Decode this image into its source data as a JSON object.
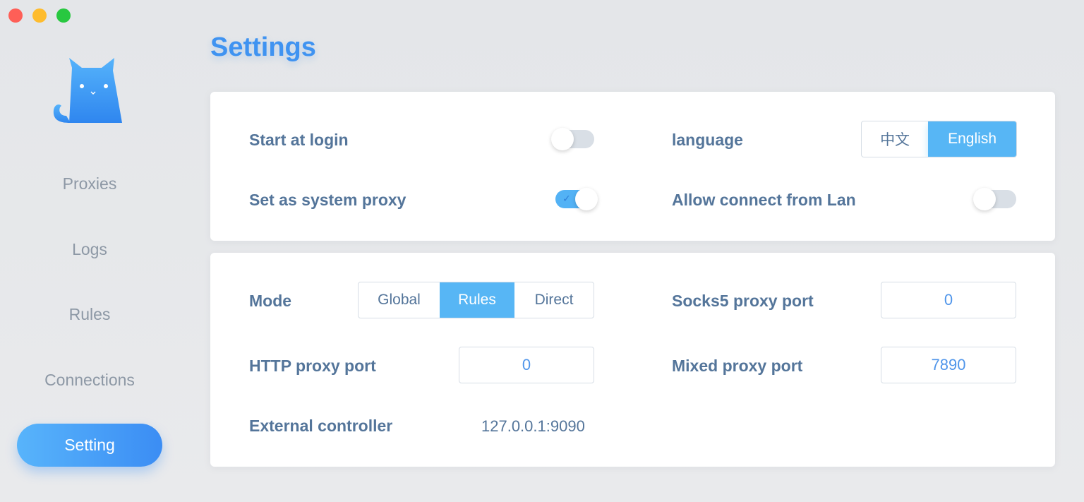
{
  "window": {
    "title": "Settings"
  },
  "sidebar": {
    "items": [
      {
        "label": "Proxies"
      },
      {
        "label": "Logs"
      },
      {
        "label": "Rules"
      },
      {
        "label": "Connections"
      },
      {
        "label": "Setting"
      }
    ],
    "active": "Setting"
  },
  "general": {
    "start_at_login": {
      "label": "Start at login",
      "enabled": false
    },
    "system_proxy": {
      "label": "Set as system proxy",
      "enabled": true
    },
    "language": {
      "label": "language",
      "options": [
        "中文",
        "English"
      ],
      "selected": "English"
    },
    "allow_lan": {
      "label": "Allow connect from Lan",
      "enabled": false
    }
  },
  "proxy": {
    "mode": {
      "label": "Mode",
      "options": [
        "Global",
        "Rules",
        "Direct"
      ],
      "selected": "Rules"
    },
    "http_port": {
      "label": "HTTP proxy port",
      "value": "0"
    },
    "socks5_port": {
      "label": "Socks5 proxy port",
      "value": "0"
    },
    "mixed_port": {
      "label": "Mixed proxy port",
      "value": "7890"
    },
    "external_controller": {
      "label": "External controller",
      "value": "127.0.0.1:9090"
    }
  },
  "colors": {
    "accent": "#3f93f1",
    "selected": "#57b6f5",
    "label": "#54759a"
  }
}
